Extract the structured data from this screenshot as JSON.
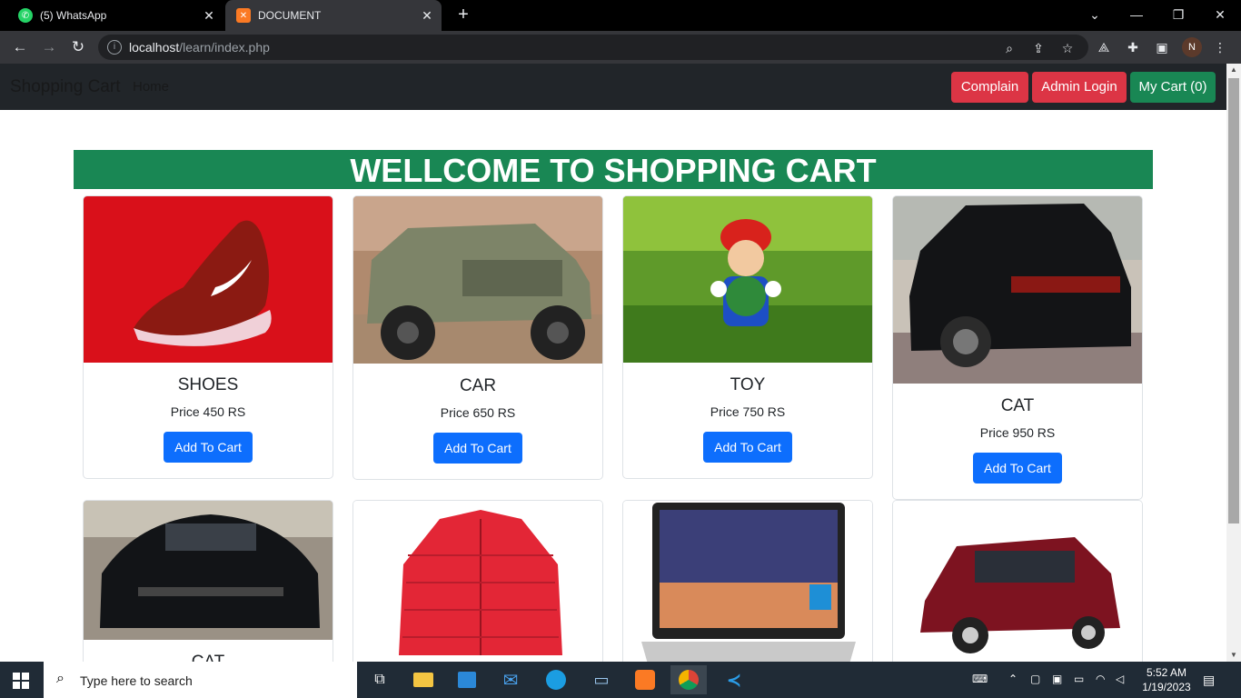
{
  "browser": {
    "tabs": [
      {
        "label": "(5) WhatsApp",
        "icon": "whatsapp-icon"
      },
      {
        "label": "DOCUMENT",
        "icon": "xampp-icon"
      }
    ],
    "url_host": "localhost",
    "url_path": "/learn/index.php"
  },
  "navbar": {
    "brand": "Shopping Cart",
    "home": "Home",
    "complain": "Complain",
    "admin_login": "Admin Login",
    "my_cart": "My Cart (0)"
  },
  "banner": "WELLCOME TO SHOPPING CART",
  "products": [
    {
      "name": "SHOES",
      "price": "Price 450 RS",
      "button": "Add To Cart"
    },
    {
      "name": "CAR",
      "price": "Price 650 RS",
      "button": "Add To Cart"
    },
    {
      "name": "TOY",
      "price": "Price 750 RS",
      "button": "Add To Cart"
    },
    {
      "name": "CAT",
      "price": "Price 950 RS",
      "button": "Add To Cart"
    },
    {
      "name": "CAT"
    }
  ],
  "taskbar": {
    "search_placeholder": "Type here to search",
    "time": "5:52 AM",
    "date": "1/19/2023"
  }
}
